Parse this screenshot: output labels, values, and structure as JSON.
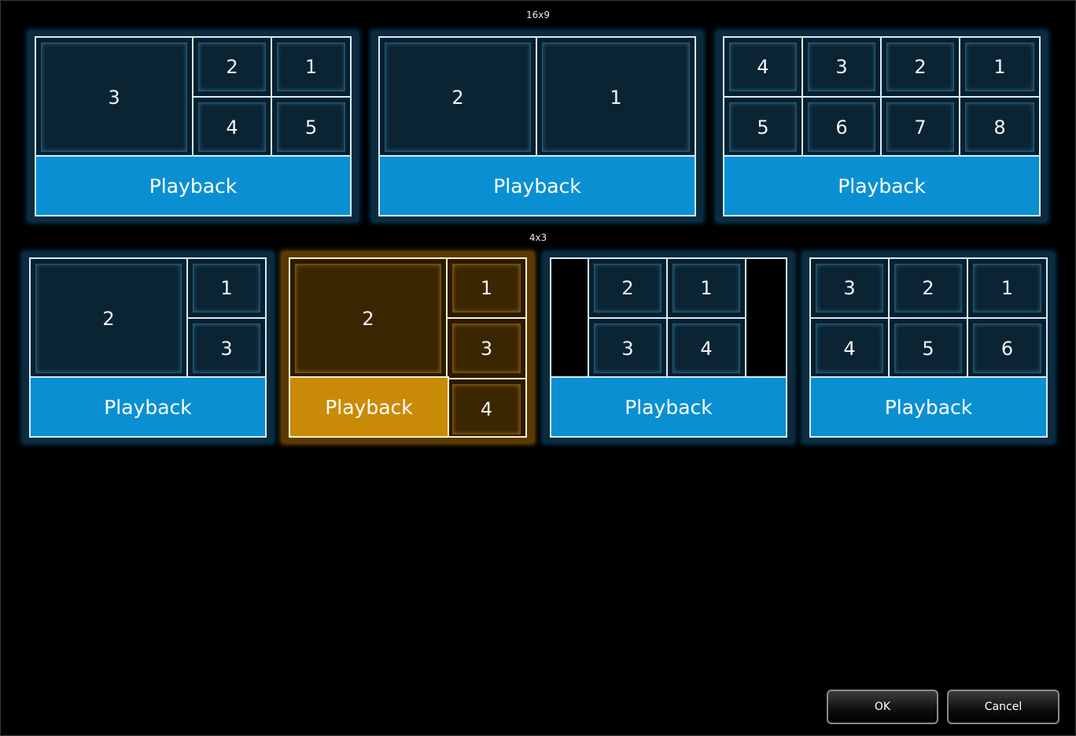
{
  "sections": {
    "wide_label": "16x9",
    "standard_label": "4x3"
  },
  "playback_label": "Playback",
  "layouts": {
    "wide": [
      {
        "cells": [
          "3",
          "2",
          "1",
          "4",
          "5"
        ]
      },
      {
        "cells": [
          "2",
          "1"
        ]
      },
      {
        "cells": [
          "4",
          "3",
          "2",
          "1",
          "5",
          "6",
          "7",
          "8"
        ]
      }
    ],
    "standard": [
      {
        "cells": [
          "2",
          "1",
          "3"
        ]
      },
      {
        "cells": [
          "2",
          "1",
          "3",
          "4"
        ],
        "selected": true
      },
      {
        "cells": [
          "2",
          "1",
          "3",
          "4"
        ]
      },
      {
        "cells": [
          "3",
          "2",
          "1",
          "4",
          "5",
          "6"
        ]
      }
    ]
  },
  "buttons": {
    "ok": "OK",
    "cancel": "Cancel"
  },
  "colors": {
    "accent_blue": "#0a90d2",
    "selected_orange": "#c98a08",
    "background": "#000000"
  }
}
